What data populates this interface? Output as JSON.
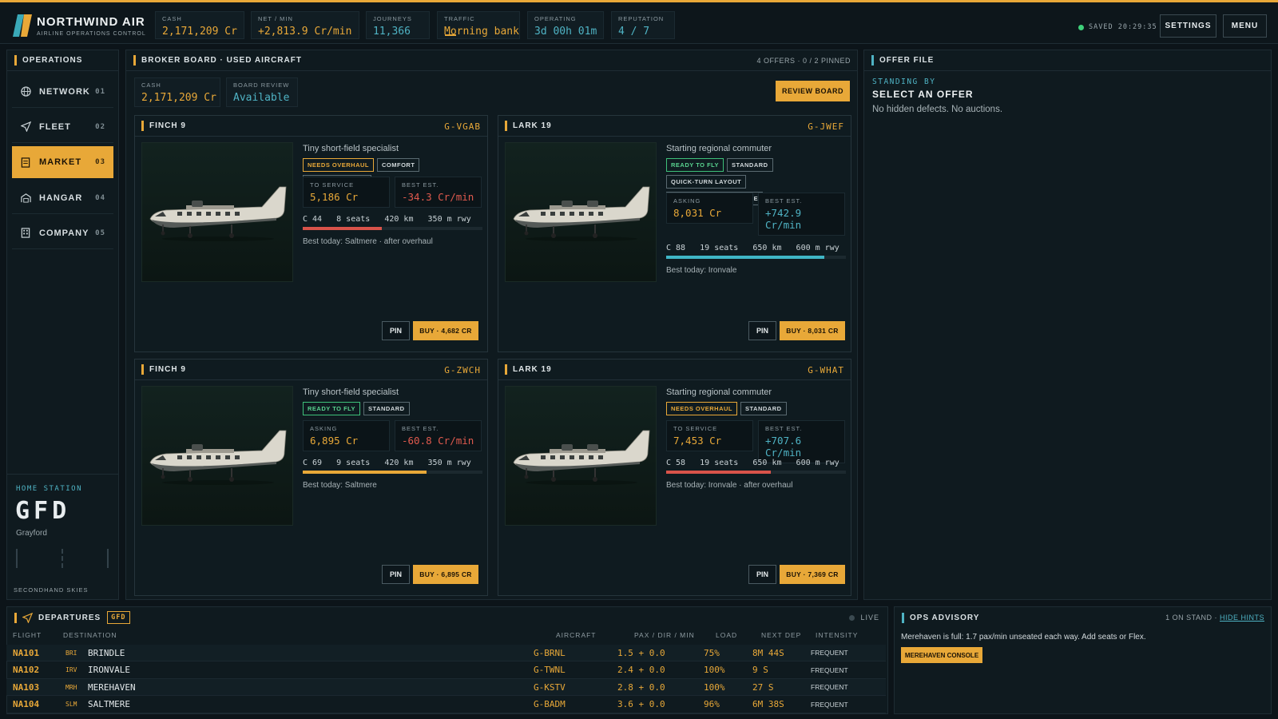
{
  "app": {
    "name": "NORTHWIND AIR",
    "subtitle": "AIRLINE OPERATIONS CONTROL"
  },
  "stats": [
    {
      "label": "CASH",
      "value": "2,171,209 Cr",
      "color": "#e8a838"
    },
    {
      "label": "NET / MIN",
      "value": "+2,813.9 Cr/min",
      "color": "#e8a838"
    },
    {
      "label": "JOURNEYS",
      "value": "11,366",
      "color": "#4fb3c4"
    },
    {
      "label": "TRAFFIC",
      "value": "Morning bank",
      "color": "#e8a838"
    },
    {
      "label": "OPERATING",
      "value": "3d 00h 01m",
      "color": "#4fb3c4"
    },
    {
      "label": "REPUTATION",
      "value": "4 / 7",
      "color": "#4fb3c4"
    }
  ],
  "saved": "SAVED 20:29:35",
  "top_buttons": {
    "settings": "SETTINGS",
    "menu": "MENU"
  },
  "sidebar": {
    "title": "OPERATIONS",
    "items": [
      {
        "label": "NETWORK",
        "num": "01",
        "icon": "globe-icon"
      },
      {
        "label": "FLEET",
        "num": "02",
        "icon": "plane-icon"
      },
      {
        "label": "MARKET",
        "num": "03",
        "icon": "document-icon",
        "active": true
      },
      {
        "label": "HANGAR",
        "num": "04",
        "icon": "hangar-icon"
      },
      {
        "label": "COMPANY",
        "num": "05",
        "icon": "building-icon"
      }
    ],
    "home_label": "HOME STATION",
    "home_code": "GFD",
    "home_name": "Grayford",
    "footer": "SECONDHAND SKIES"
  },
  "broker": {
    "title": "BROKER BOARD · USED AIRCRAFT",
    "meta": "4 OFFERS · 0 / 2 PINNED",
    "cash_label": "CASH",
    "cash_value": "2,171,209 Cr",
    "review_label": "BOARD REVIEW",
    "review_value": "Available",
    "review_button": "REVIEW BOARD",
    "offers": [
      {
        "model": "FINCH 9",
        "reg": "G-VGAB",
        "desc": "Tiny short-field specialist",
        "tags": [
          {
            "t": "NEEDS OVERHAUL",
            "k": "warn"
          },
          {
            "t": "COMFORT",
            "k": ""
          },
          {
            "t": "FRUGAL ENGINES",
            "k": ""
          }
        ],
        "m1_label": "TO SERVICE",
        "m1_value": "5,186 Cr",
        "m1_color": "#e8a838",
        "m2_label": "BEST EST.",
        "m2_value": "-34.3 Cr/min",
        "m2_color": "#e05a4e",
        "specs": "C 44   8 seats   420 km   350 m rwy",
        "condition": 44,
        "bar_color": "#d9534a",
        "best": "Best today: Saltmere · after overhaul",
        "pin": "PIN",
        "buy": "BUY · 4,682 CR"
      },
      {
        "model": "LARK 19",
        "reg": "G-JWEF",
        "desc": "Starting regional commuter",
        "tags": [
          {
            "t": "READY TO FLY",
            "k": "ok"
          },
          {
            "t": "STANDARD",
            "k": ""
          },
          {
            "t": "QUICK-TURN LAYOUT",
            "k": ""
          },
          {
            "t": "HIGH-CYCLE WORKHORSE",
            "k": ""
          }
        ],
        "m1_label": "ASKING",
        "m1_value": "8,031 Cr",
        "m1_color": "#e8a838",
        "m2_label": "BEST EST.",
        "m2_value": "+742.9 Cr/min",
        "m2_color": "#4fb3c4",
        "specs": "C 88   19 seats   650 km   600 m rwy",
        "condition": 88,
        "bar_color": "#3fb6c6",
        "best": "Best today: Ironvale",
        "pin": "PIN",
        "buy": "BUY · 8,031 CR"
      },
      {
        "model": "FINCH 9",
        "reg": "G-ZWCH",
        "desc": "Tiny short-field specialist",
        "tags": [
          {
            "t": "READY TO FLY",
            "k": "ok"
          },
          {
            "t": "STANDARD",
            "k": ""
          }
        ],
        "m1_label": "ASKING",
        "m1_value": "6,895 Cr",
        "m1_color": "#e8a838",
        "m2_label": "BEST EST.",
        "m2_value": "-60.8 Cr/min",
        "m2_color": "#e05a4e",
        "specs": "C 69   9 seats   420 km   350 m rwy",
        "condition": 69,
        "bar_color": "#e8a838",
        "best": "Best today: Saltmere",
        "pin": "PIN",
        "buy": "BUY · 6,895 CR"
      },
      {
        "model": "LARK 19",
        "reg": "G-WHAT",
        "desc": "Starting regional commuter",
        "tags": [
          {
            "t": "NEEDS OVERHAUL",
            "k": "warn"
          },
          {
            "t": "STANDARD",
            "k": ""
          }
        ],
        "m1_label": "TO SERVICE",
        "m1_value": "7,453 Cr",
        "m1_color": "#e8a838",
        "m2_label": "BEST EST.",
        "m2_value": "+707.6 Cr/min",
        "m2_color": "#4fb3c4",
        "specs": "C 58   19 seats   650 km   600 m rwy",
        "condition": 58,
        "bar_color": "#d9534a",
        "best": "Best today: Ironvale · after overhaul",
        "pin": "PIN",
        "buy": "BUY · 7,369 CR"
      }
    ]
  },
  "offer_file": {
    "title": "OFFER FILE",
    "status": "STANDING BY",
    "heading": "SELECT AN OFFER",
    "note": "No hidden defects. No auctions."
  },
  "departures": {
    "title": "DEPARTURES",
    "station": "GFD",
    "live": "LIVE",
    "columns": [
      "FLIGHT",
      "DESTINATION",
      "AIRCRAFT",
      "PAX / DIR / MIN",
      "LOAD",
      "NEXT DEP",
      "INTENSITY"
    ],
    "rows": [
      {
        "flight": "NA101",
        "code": "BRI",
        "dest": "BRINDLE",
        "aircraft": "G-BRNL",
        "pax": "1.5 + 0.0",
        "load": "75%",
        "next": "8M 44S",
        "intensity": "FREQUENT"
      },
      {
        "flight": "NA102",
        "code": "IRV",
        "dest": "IRONVALE",
        "aircraft": "G-TWNL",
        "pax": "2.4 + 0.0",
        "load": "100%",
        "next": "9 S",
        "intensity": "FREQUENT"
      },
      {
        "flight": "NA103",
        "code": "MRH",
        "dest": "MEREHAVEN",
        "aircraft": "G-KSTV",
        "pax": "2.8 + 0.0",
        "load": "100%",
        "next": "27 S",
        "intensity": "FREQUENT"
      },
      {
        "flight": "NA104",
        "code": "SLM",
        "dest": "SALTMERE",
        "aircraft": "G-BADM",
        "pax": "3.6 + 0.0",
        "load": "96%",
        "next": "6M 38S",
        "intensity": "FREQUENT"
      }
    ]
  },
  "advisory": {
    "title": "OPS ADVISORY",
    "meta": "1 ON STAND ·",
    "hide": "HIDE HINTS",
    "text": "Merehaven is full: 1.7 pax/min unseated each way. Add seats or Flex.",
    "button": "MEREHAVEN CONSOLE"
  }
}
